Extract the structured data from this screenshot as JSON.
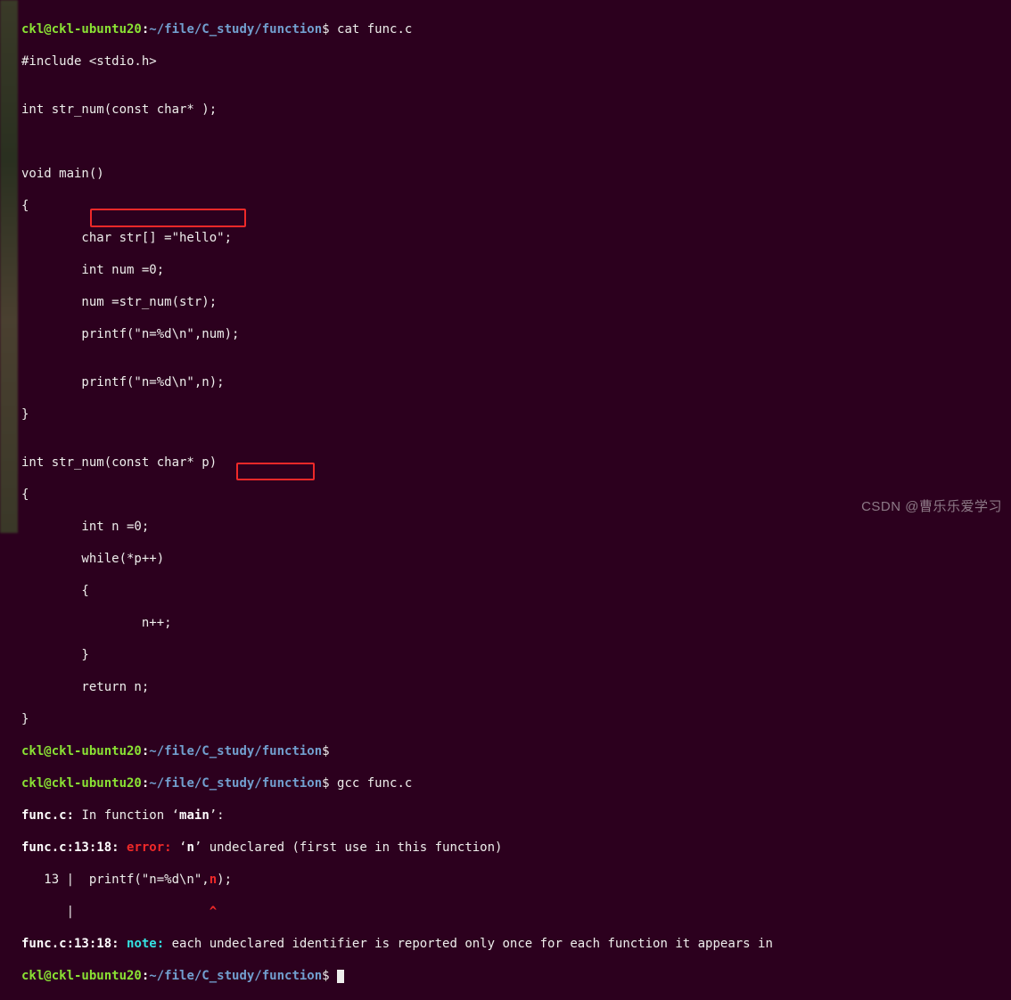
{
  "prompt": {
    "user": "ckl@ckl-ubuntu20",
    "path": "~/file/C_study/function",
    "dollar": "$"
  },
  "cmd1": " cat func.c",
  "code": {
    "l1": "#include <stdio.h>",
    "l2": "",
    "l3": "int str_num(const char* );",
    "l4": "",
    "l5": "",
    "l6": "void main()",
    "l7": "{",
    "l8": "        char str[] =\"hello\";",
    "l9": "        int num =0;",
    "l10": "        num =str_num(str);",
    "l11": "        printf(\"n=%d\\n\",num);",
    "l12": "",
    "l13": "        printf(\"n=%d\\n\",n);",
    "l14": "}",
    "l15": "",
    "l16": "int str_num(const char* p)",
    "l17": "{",
    "l18": "        int n =0;",
    "l19": "        while(*p++)",
    "l20": "        {",
    "l21": "                n++;",
    "l22": "        }",
    "l23": "        return n;",
    "l24": "}"
  },
  "cmd2": "",
  "cmd3": " gcc func.c",
  "out": {
    "o1a": "func.c:",
    "o1b": " In function ‘",
    "o1c": "main",
    "o1d": "’:",
    "o2a": "func.c:13:18:",
    "o2b": " ",
    "o2err": "error:",
    "o2c": " ‘",
    "o2n": "n",
    "o2d": "’ ",
    "o2u": "undeclared ",
    "o2e": "(first use in this function)",
    "o3": "   13 |  printf(\"n=%d\\n\",",
    "o3n": "n",
    "o3b": ");",
    "o4": "      |                  ",
    "o4c": "^",
    "o5a": "func.c:13:18:",
    "o5b": " ",
    "o5note": "note:",
    "o5c": " each undeclared identifier is reported only once for each function it appears in"
  },
  "watermark": "CSDN @曹乐乐爱学习"
}
